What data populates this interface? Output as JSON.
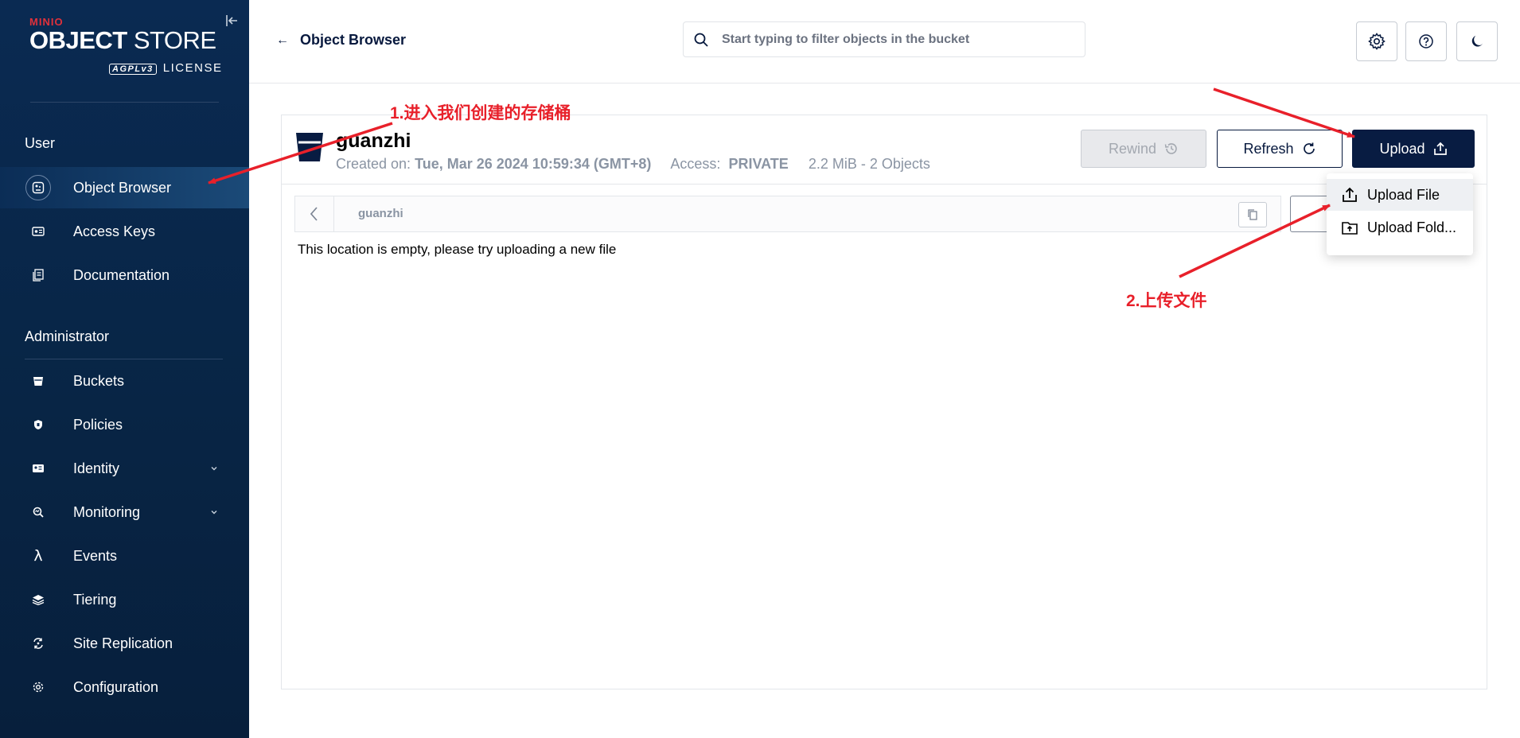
{
  "colors": {
    "navy": "#081c42",
    "sidebar": "#0a2a52",
    "annotation": "#e8202a",
    "brand_red": "#e0313b"
  },
  "logo": {
    "brand": "MINIO",
    "product_bold": "OBJECT",
    "product_rest": " STORE",
    "agpl": "AGPLv3",
    "license": "LICENSE"
  },
  "sidebar": {
    "user_section": "User",
    "admin_section": "Administrator",
    "user_items": [
      {
        "label": "Object Browser",
        "icon": "object-browser-icon"
      },
      {
        "label": "Access Keys",
        "icon": "key-icon"
      },
      {
        "label": "Documentation",
        "icon": "document-icon"
      }
    ],
    "admin_items": [
      {
        "label": "Buckets",
        "icon": "bucket-icon"
      },
      {
        "label": "Policies",
        "icon": "shield-icon"
      },
      {
        "label": "Identity",
        "icon": "id-card-icon"
      },
      {
        "label": "Monitoring",
        "icon": "monitor-icon"
      },
      {
        "label": "Events",
        "icon": "lambda-icon"
      },
      {
        "label": "Tiering",
        "icon": "layers-icon"
      },
      {
        "label": "Site Replication",
        "icon": "replication-icon"
      },
      {
        "label": "Configuration",
        "icon": "gear-icon"
      }
    ]
  },
  "header": {
    "title": "Object Browser",
    "search_placeholder": "Start typing to filter objects in the bucket"
  },
  "bucket": {
    "name": "guanzhi",
    "created_label": "Created on:",
    "created_value": "Tue, Mar 26 2024 10:59:34 (GMT+8)",
    "access_label": "Access:",
    "access_value": "PRIVATE",
    "usage": "2.2 MiB - 2 Objects",
    "rewind": "Rewind",
    "refresh": "Refresh",
    "upload": "Upload",
    "path": "guanzhi",
    "empty_message": "This location is empty, please try uploading a new file"
  },
  "upload_menu": {
    "file": "Upload File",
    "folder": "Upload Fold..."
  },
  "annotations": {
    "step1": "1.进入我们创建的存储桶",
    "step2": "2.上传文件"
  }
}
